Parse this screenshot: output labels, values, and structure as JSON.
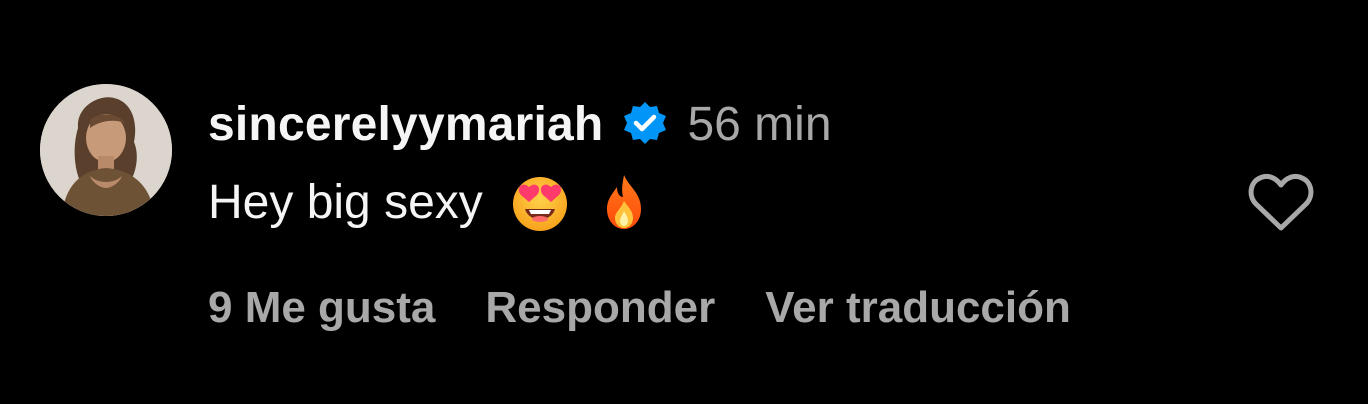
{
  "comment": {
    "username": "sincerelyymariah",
    "verified": true,
    "timestamp": "56 min",
    "text": "Hey big sexy",
    "emojis": [
      "heart-eyes-emoji",
      "fire-emoji"
    ],
    "actions": {
      "likes": "9 Me gusta",
      "reply": "Responder",
      "translate": "Ver traducción"
    }
  },
  "icons": {
    "verified_badge": "verified-check-icon",
    "like": "heart-outline-icon"
  },
  "colors": {
    "background": "#000000",
    "primary_text": "#f5f5f5",
    "secondary_text": "#a8a8a8",
    "verified_blue": "#0095f6"
  }
}
